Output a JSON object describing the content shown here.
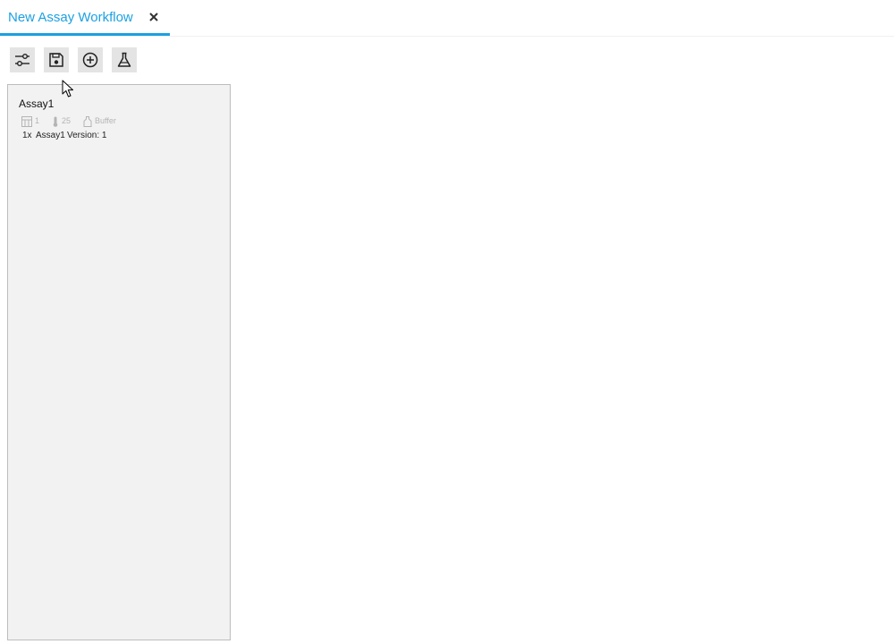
{
  "tab": {
    "title": "New Assay Workflow",
    "close_icon": "close-icon",
    "accent_color": "#1ba1e2"
  },
  "toolbar": {
    "buttons": [
      {
        "icon": "sliders-icon"
      },
      {
        "icon": "save-icon"
      },
      {
        "icon": "add-circle-icon"
      },
      {
        "icon": "flask-icon"
      }
    ]
  },
  "workflow": {
    "assays": [
      {
        "name": "Assay1",
        "plate_count": "1",
        "temperature": "25",
        "buffer": "Buffer",
        "multiplier": "1x",
        "assay_ref": "Assay1",
        "version": "Version: 1"
      }
    ]
  }
}
